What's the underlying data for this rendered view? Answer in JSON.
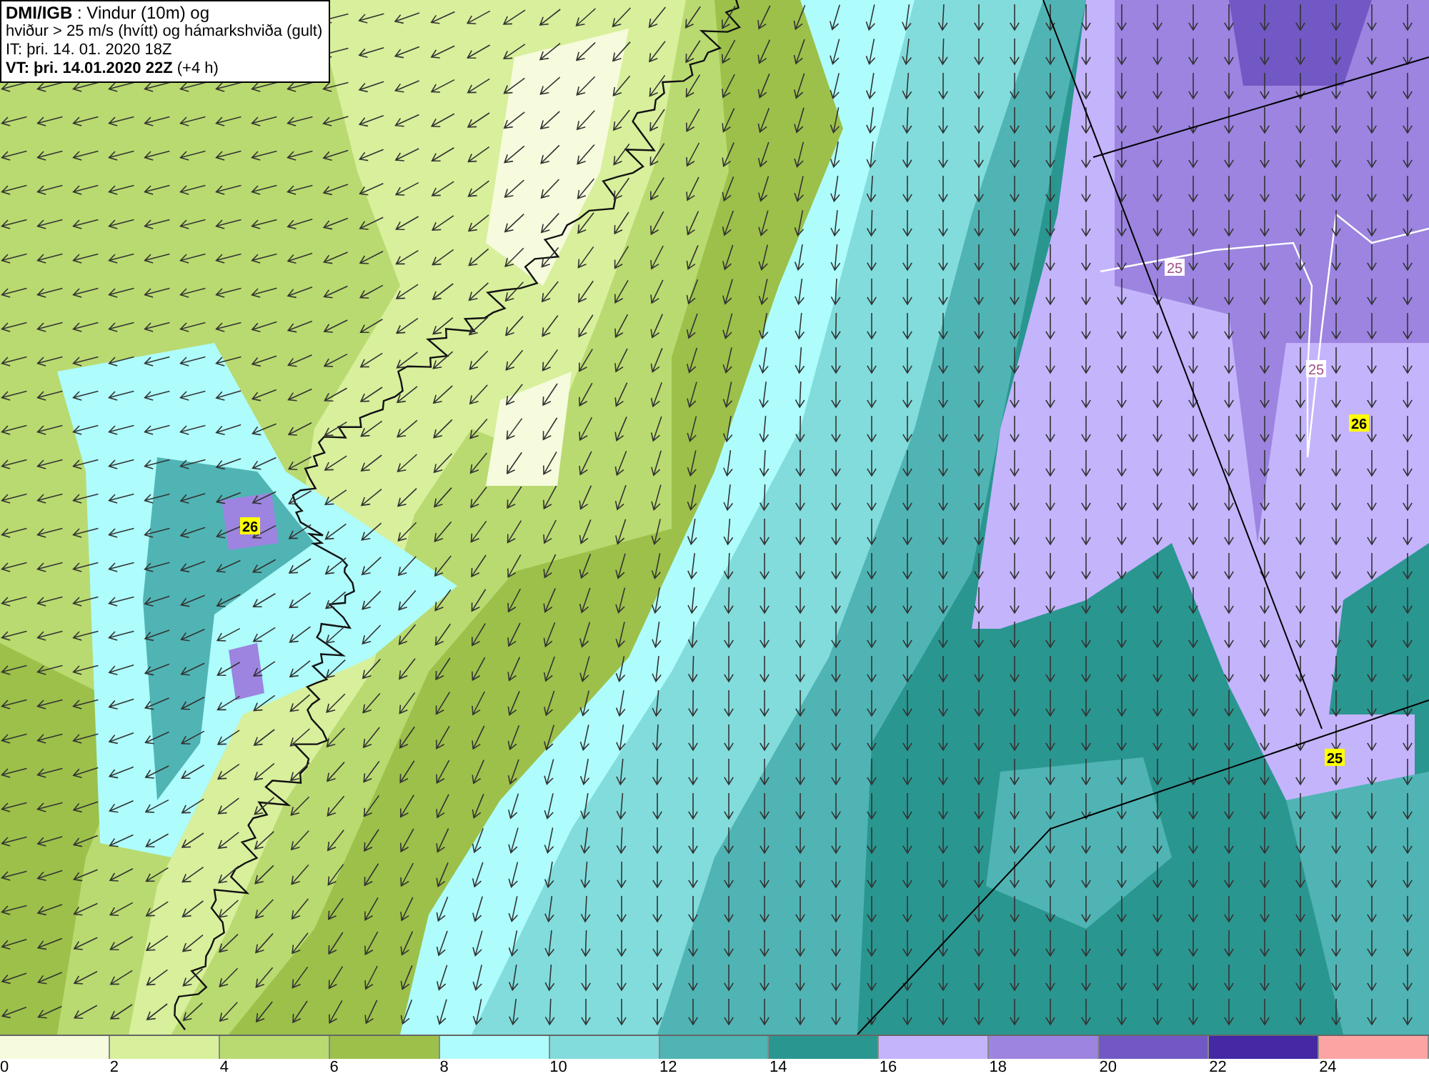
{
  "header": {
    "lines": [
      "**DMI/IGB** : Vindur (10m) og",
      "hviður > 25 m/s (hvítt) og hámarkshviða (gult)",
      "IT: þri. 14. 01. 2020 18Z",
      "**VT: þri. 14.01.2020 22Z** (+4 h)"
    ]
  },
  "map": {
    "labels": [
      {
        "text": "25",
        "kind": "gust"
      },
      {
        "text": "25",
        "kind": "gust"
      },
      {
        "text": "26",
        "kind": "max"
      },
      {
        "text": "26",
        "kind": "max"
      },
      {
        "text": "25",
        "kind": "max"
      }
    ]
  },
  "legend": {
    "bins": [
      {
        "tick": "0",
        "color": "#f5fbdc"
      },
      {
        "tick": "2",
        "color": "#d8ef9c"
      },
      {
        "tick": "4",
        "color": "#b9da70"
      },
      {
        "tick": "6",
        "color": "#9cc04a"
      },
      {
        "tick": "8",
        "color": "#aefcfc"
      },
      {
        "tick": "10",
        "color": "#82dcdc"
      },
      {
        "tick": "12",
        "color": "#50b4b4"
      },
      {
        "tick": "14",
        "color": "#2a9690"
      },
      {
        "tick": "16",
        "color": "#c4b4fc"
      },
      {
        "tick": "18",
        "color": "#9c84e0"
      },
      {
        "tick": "20",
        "color": "#7258c4"
      },
      {
        "tick": "22",
        "color": "#4428a4"
      },
      {
        "tick": "24",
        "color": "#fca4a4"
      }
    ]
  }
}
